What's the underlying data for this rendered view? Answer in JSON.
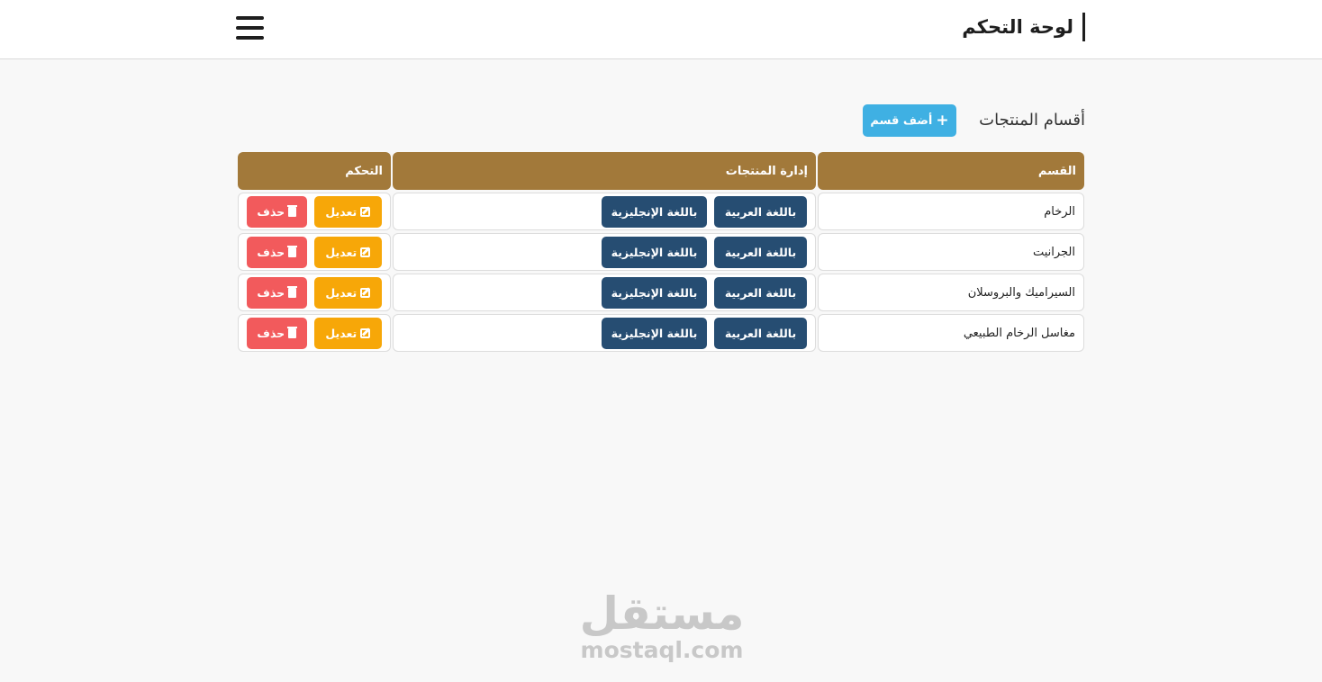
{
  "header": {
    "title": "لوحة التحكم",
    "menu_icon": "hamburger-icon"
  },
  "main": {
    "section_title": "أقسام المنتجات",
    "add_button": {
      "label": "أضف قسم",
      "icon": "plus-icon",
      "color": "#3fb0e3"
    }
  },
  "table": {
    "columns": [
      "القسم",
      "إدارة المنتجات",
      "التحكم"
    ],
    "header_color": "#a2793a",
    "rows": [
      {
        "category": "الرخام",
        "arabic_label": "باللغة العربية",
        "english_label": "باللغة الإنجليزية",
        "edit_label": "تعديل",
        "delete_label": "حذف"
      },
      {
        "category": "الجرانيت",
        "arabic_label": "باللغة العربية",
        "english_label": "باللغة الإنجليزية",
        "edit_label": "تعديل",
        "delete_label": "حذف"
      },
      {
        "category": "السيراميك والبروسلان",
        "arabic_label": "باللغة العربية",
        "english_label": "باللغة الإنجليزية",
        "edit_label": "تعديل",
        "delete_label": "حذف"
      },
      {
        "category": "مغاسل الرخام الطبيعي",
        "arabic_label": "باللغة العربية",
        "english_label": "باللغة الإنجليزية",
        "edit_label": "تعديل",
        "delete_label": "حذف"
      }
    ],
    "button_colors": {
      "language": "#264d72",
      "edit": "#f7a708",
      "delete": "#f25a5c"
    }
  },
  "watermark": {
    "arabic": "مستقل",
    "latin": "mostaql.com"
  }
}
